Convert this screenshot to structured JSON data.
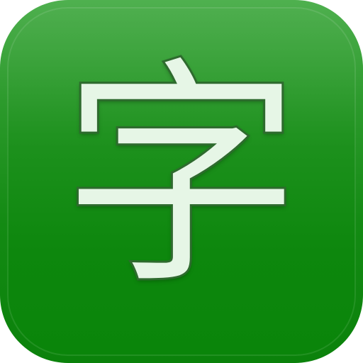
{
  "icon": {
    "glyph": "字",
    "background_colors": [
      "#4fb04f",
      "#138a13",
      "#0b820b"
    ],
    "glyph_fill_color": "#e6f6e6",
    "glyph_outline_color": "#2e6b2e"
  }
}
